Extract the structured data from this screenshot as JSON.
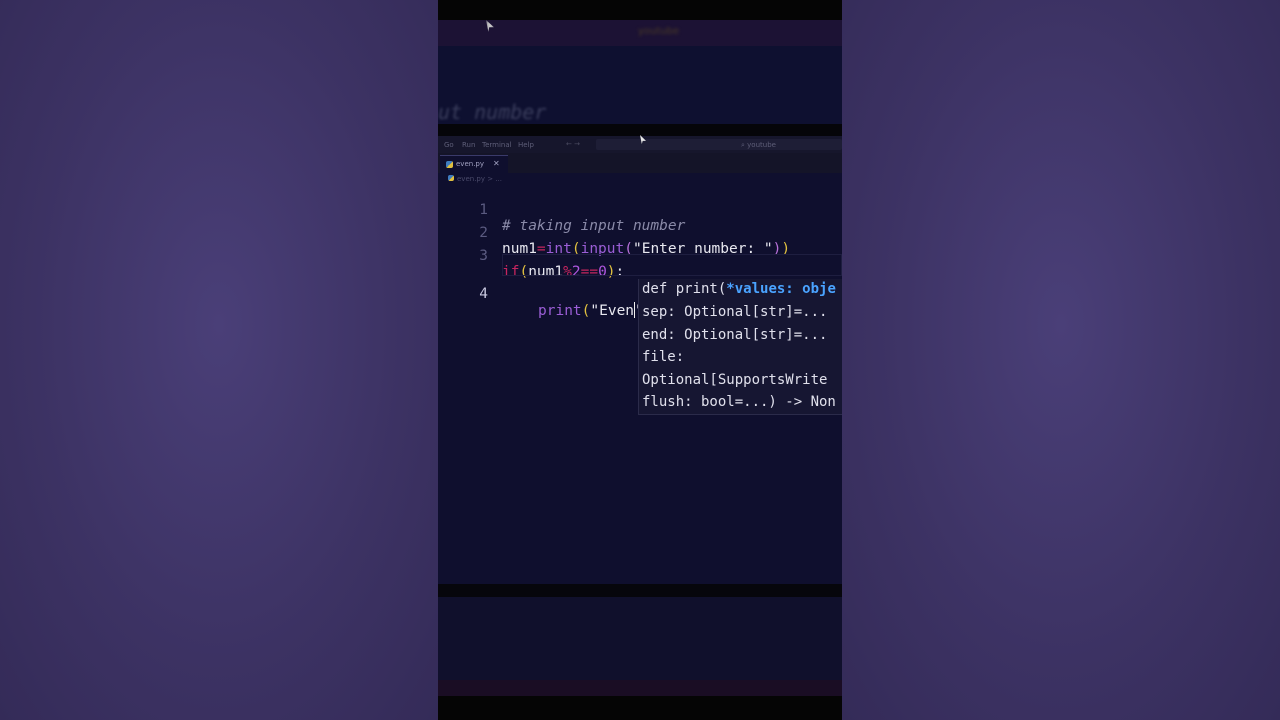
{
  "background": {
    "colors": {
      "side": "#3f3566",
      "editor": "#0f0f2e"
    }
  },
  "blurred_header": {
    "label": "youtube",
    "code_text": "ut number"
  },
  "menubar": {
    "items": [
      "Go",
      "Run",
      "Terminal",
      "Help"
    ],
    "nav": "←  →",
    "search": "youtube"
  },
  "tab": {
    "filename": "even.py",
    "close": "✕"
  },
  "breadcrumb": {
    "path": "even.py > ..."
  },
  "editor": {
    "lines": [
      {
        "num": "1",
        "text": "# taking input number"
      },
      {
        "num": "2",
        "tokens": [
          "num1",
          "=",
          "int",
          "(",
          "input",
          "(",
          "\"Enter number: \"",
          ")",
          ")"
        ]
      },
      {
        "num": "3",
        "tokens": [
          "if",
          "(",
          "num1",
          "%",
          "2",
          "==",
          "0",
          ")",
          ":"
        ]
      },
      {
        "num": "4",
        "tokens": [
          "print",
          "(",
          "\"Even",
          "\"",
          ")"
        ]
      }
    ]
  },
  "hover": {
    "line1_prefix": "def print(",
    "line1_param": "*values: obje",
    "line2": "sep: Optional[str]=...",
    "line3": "end: Optional[str]=...",
    "line4": "file:",
    "line5": "Optional[SupportsWrite",
    "line6": "flush: bool=...) -> Non"
  }
}
